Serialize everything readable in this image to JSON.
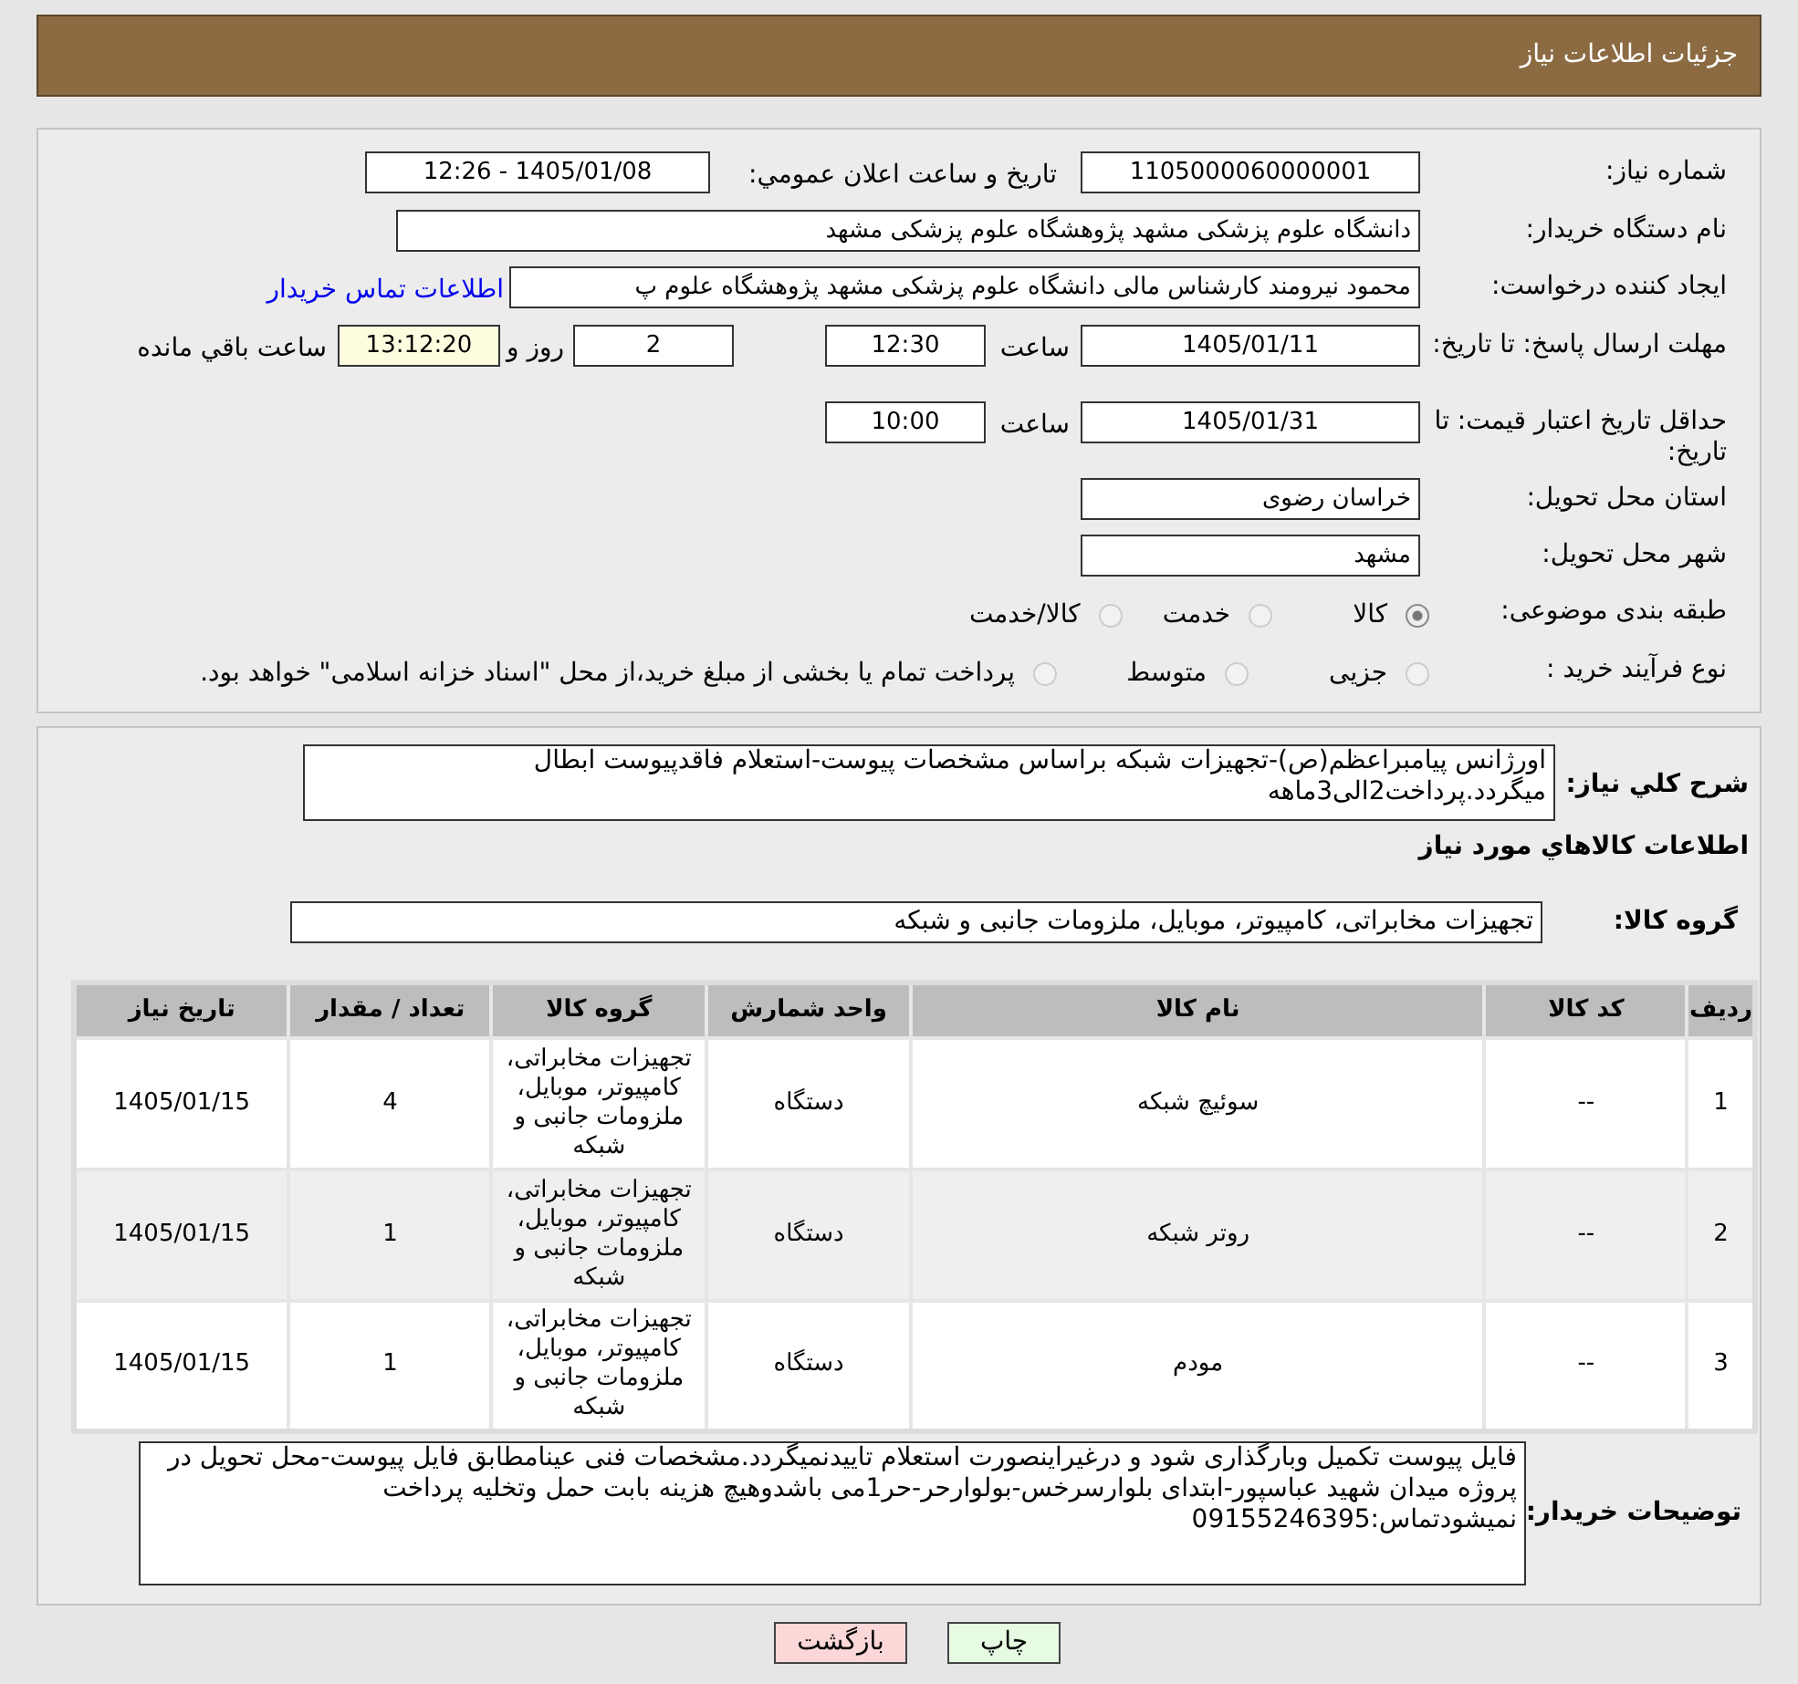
{
  "header": {
    "title": "جزئیات اطلاعات نیاز"
  },
  "details": {
    "need_number": {
      "label": "شماره نیاز:",
      "value": "1105000060000001"
    },
    "announce": {
      "label": "تاريخ و ساعت اعلان عمومي:",
      "value": "1405/01/08 - 12:26"
    },
    "buyer": {
      "label": "نام دستگاه خریدار:",
      "value": "دانشگاه علوم پزشکی مشهد   پژوهشگاه علوم پزشکی مشهد"
    },
    "creator": {
      "label": "ایجاد کننده درخواست:",
      "value": "محمود نیرومند کارشناس مالی دانشگاه علوم پزشکی مشهد   پژوهشگاه علوم پ",
      "link": "اطلاعات تماس خریدار"
    },
    "deadline": {
      "label": "مهلت ارسال پاسخ: تا تاریخ:",
      "date": "1405/01/11",
      "time_label": "ساعت",
      "time": "12:30",
      "days": "2",
      "days_label": "روز و",
      "remaining": "13:12:20",
      "remaining_label": "ساعت باقي مانده"
    },
    "validity": {
      "label": "حداقل تاريخ اعتبار قیمت: تا تاریخ:",
      "date": "1405/01/31",
      "time_label": "ساعت",
      "time": "10:00"
    },
    "province": {
      "label": "استان محل تحویل:",
      "value": "خراسان رضوی"
    },
    "city": {
      "label": "شهر محل تحویل:",
      "value": "مشهد"
    },
    "category": {
      "label": "طبقه بندی موضوعی:",
      "options": [
        {
          "label": "کالا",
          "selected": true
        },
        {
          "label": "خدمت",
          "selected": false
        },
        {
          "label": "کالا/خدمت",
          "selected": false
        }
      ]
    },
    "process": {
      "label": "نوع فرآیند خرید :",
      "options": [
        {
          "label": "جزیی",
          "selected": false
        },
        {
          "label": "متوسط",
          "selected": false
        },
        {
          "label": "پرداخت تمام یا بخشی از مبلغ خرید،از محل \"اسناد خزانه اسلامی\" خواهد بود.",
          "selected": false
        }
      ]
    }
  },
  "summary": {
    "label": "شرح کلي نیاز:",
    "value": "اورژانس پیامبراعظم(ص)-تجهیزات شبکه براساس مشخصات پیوست-استعلام فاقدپیوست ابطال میگردد.پرداخت2الی3ماهه"
  },
  "goods_title": "اطلاعات کالاهاي مورد نیاز",
  "goods_group": {
    "label": "گروه کالا:",
    "value": "تجهیزات مخابراتی، کامپیوتر، موبایل، ملزومات جانبی و شبکه"
  },
  "table": {
    "columns": [
      "ردیف",
      "کد کالا",
      "نام کالا",
      "واحد شمارش",
      "گروه کالا",
      "تعداد / مقدار",
      "تاریخ نیاز"
    ],
    "rows": [
      [
        "1",
        "--",
        "سوئیچ شبکه",
        "دستگاه",
        "تجهیزات مخابراتی، کامپیوتر، موبایل، ملزومات جانبی و شبکه",
        "4",
        "1405/01/15"
      ],
      [
        "2",
        "--",
        "روتر شبکه",
        "دستگاه",
        "تجهیزات مخابراتی، کامپیوتر، موبایل، ملزومات جانبی و شبکه",
        "1",
        "1405/01/15"
      ],
      [
        "3",
        "--",
        "مودم",
        "دستگاه",
        "تجهیزات مخابراتی، کامپیوتر، موبایل، ملزومات جانبی و شبکه",
        "1",
        "1405/01/15"
      ]
    ]
  },
  "notes": {
    "label": "توضیحات خریدار:",
    "value": "فایل پیوست تکمیل وبارگذاری شود و درغیراینصورت استعلام تاییدنمیگردد.مشخصات فنی عینامطابق فایل پیوست-محل تحویل در پروژه میدان شهید عباسپور-ابتدای بلوارسرخس-بولوارحر-حر1می باشدوهیچ هزینه بابت حمل وتخلیه پرداخت نمیشودتماس:09155246395"
  },
  "buttons": [
    {
      "label": "چاپ",
      "kind": "print"
    },
    {
      "label": "بازگشت",
      "kind": "back"
    }
  ]
}
